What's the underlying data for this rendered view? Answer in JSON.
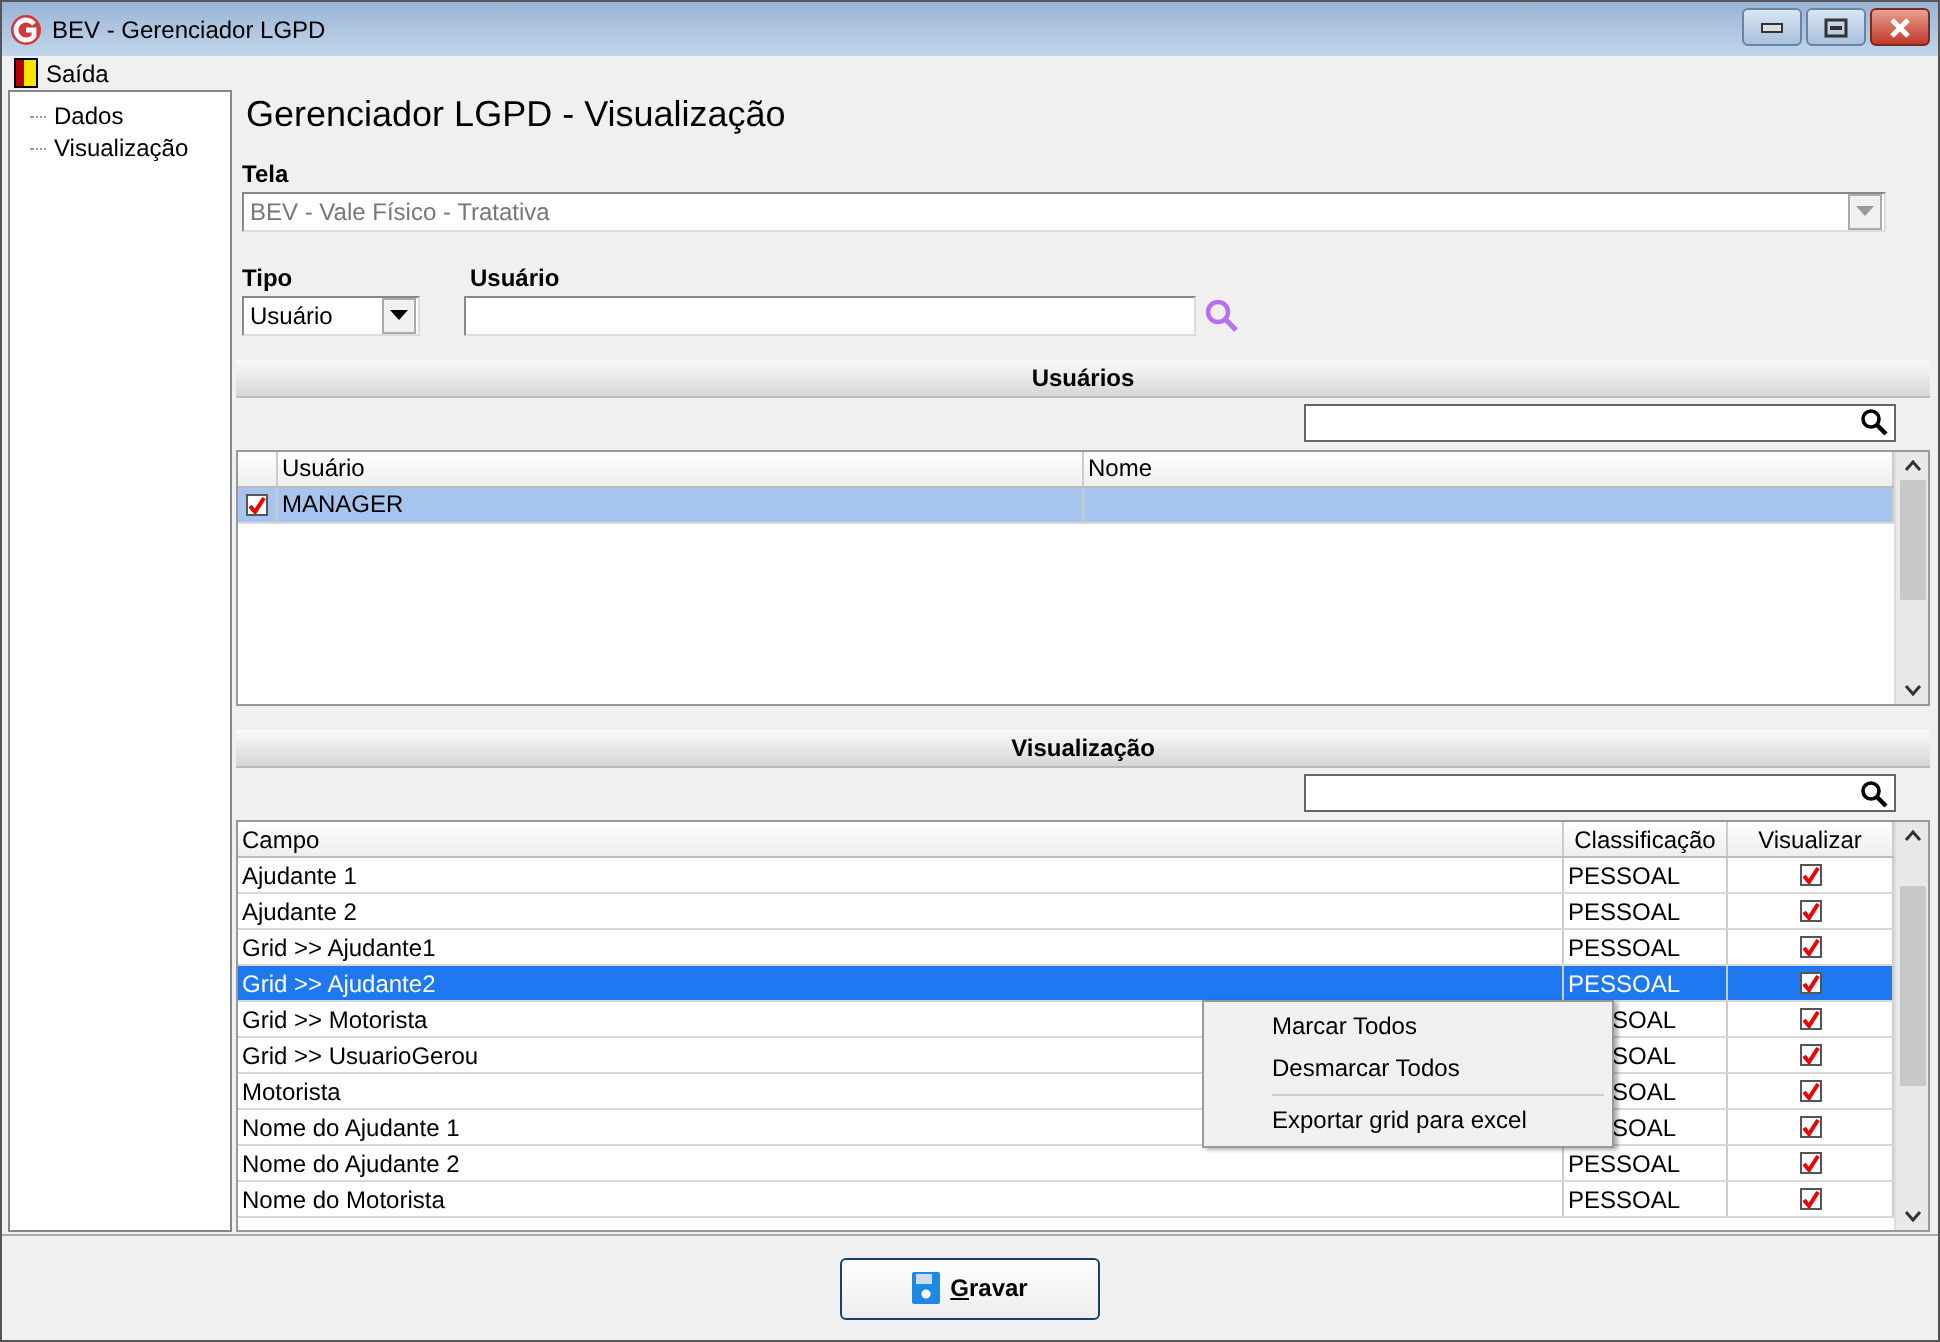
{
  "window": {
    "title": "BEV - Gerenciador LGPD"
  },
  "menu": [
    {
      "label": "Saída"
    }
  ],
  "tree": [
    {
      "label": "Dados"
    },
    {
      "label": "Visualização"
    }
  ],
  "heading": "Gerenciador LGPD - Visualização",
  "tela": {
    "label": "Tela",
    "value": "BEV - Vale Físico - Tratativa",
    "disabled": true
  },
  "tipo": {
    "label": "Tipo",
    "value": "Usuário"
  },
  "usuario": {
    "label": "Usuário"
  },
  "users_section": {
    "title": "Usuários",
    "columns": [
      "Usuário",
      "Nome"
    ],
    "rows": [
      {
        "usuario": "MANAGER",
        "checked": true,
        "selected": true
      }
    ]
  },
  "view_section": {
    "title": "Visualização",
    "columns": [
      "Campo",
      "Classificação",
      "Visualizar"
    ],
    "rows": [
      {
        "campo": "Ajudante 1",
        "classificacao": "PESSOAL",
        "visualizar": true,
        "selected": false,
        "under_menu": false
      },
      {
        "campo": "Ajudante 2",
        "classificacao": "PESSOAL",
        "visualizar": true,
        "selected": false,
        "under_menu": false
      },
      {
        "campo": "Grid >> Ajudante1",
        "classificacao": "PESSOAL",
        "visualizar": true,
        "selected": false,
        "under_menu": false
      },
      {
        "campo": "Grid >> Ajudante2",
        "classificacao": "PESSOAL",
        "visualizar": true,
        "selected": true,
        "under_menu": false
      },
      {
        "campo": "Grid >> Motorista",
        "classificacao": "SOAL",
        "visualizar": true,
        "selected": false,
        "under_menu": true
      },
      {
        "campo": "Grid >> UsuarioGerou",
        "classificacao": "SOAL",
        "visualizar": true,
        "selected": false,
        "under_menu": true
      },
      {
        "campo": "Motorista",
        "classificacao": "SOAL",
        "visualizar": true,
        "selected": false,
        "under_menu": true
      },
      {
        "campo": "Nome do Ajudante 1",
        "classificacao": "SOAL",
        "visualizar": true,
        "selected": false,
        "under_menu": true
      },
      {
        "campo": "Nome do Ajudante 2",
        "classificacao": "PESSOAL",
        "visualizar": true,
        "selected": false,
        "under_menu": false
      },
      {
        "campo": "Nome do Motorista",
        "classificacao": "PESSOAL",
        "visualizar": true,
        "selected": false,
        "under_menu": false
      }
    ]
  },
  "context_menu": {
    "items": [
      {
        "kind": "item",
        "label": "Marcar Todos"
      },
      {
        "kind": "item",
        "label": "Desmarcar Todos"
      },
      {
        "kind": "separator"
      },
      {
        "kind": "item",
        "label": "Exportar grid para excel"
      }
    ]
  },
  "save_button": {
    "label": "Gravar"
  }
}
